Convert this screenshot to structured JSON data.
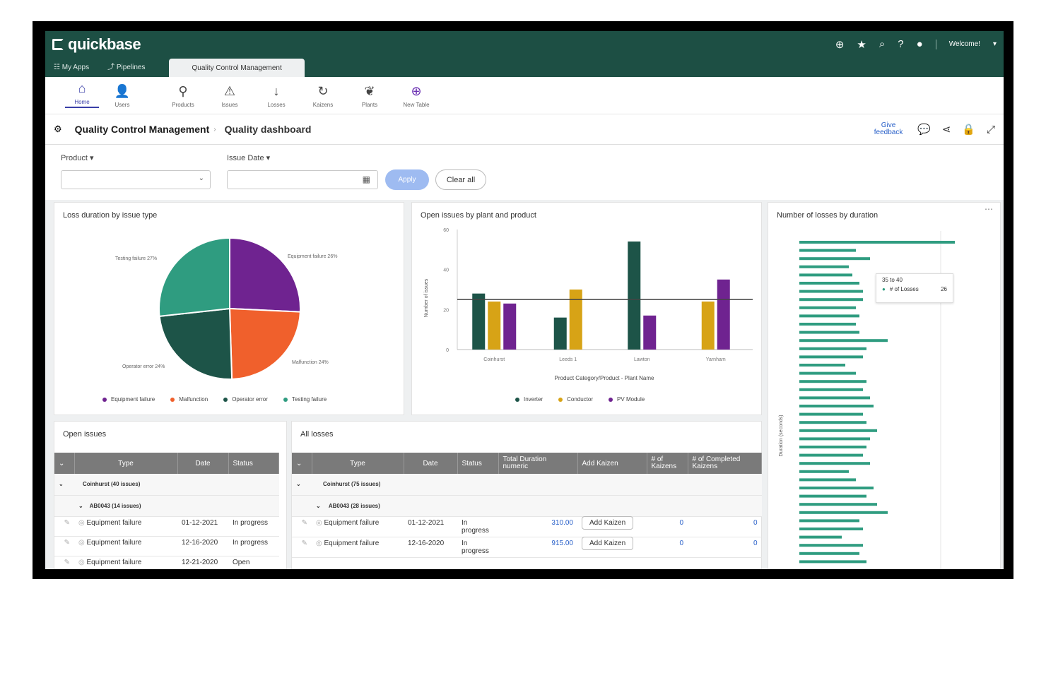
{
  "app": {
    "brand": "quickbase",
    "welcome": "Welcome!",
    "nav": {
      "my_apps": "My Apps",
      "pipelines": "Pipelines",
      "app_tab": "Quality Control Management"
    }
  },
  "tables": [
    "Home",
    "Users",
    "Products",
    "Issues",
    "Losses",
    "Kaizens",
    "Plants",
    "New Table"
  ],
  "breadcrumb": {
    "app": "Quality Control Management",
    "page": "Quality dashboard"
  },
  "give_feedback": "Give feedback",
  "filters": {
    "product_label": "Product",
    "issue_date_label": "Issue Date",
    "apply": "Apply",
    "clear_all": "Clear all"
  },
  "pie": {
    "title": "Loss duration by issue type",
    "labels": [
      "Equipment failure 26%",
      "Malfunction 24%",
      "Operator error 24%",
      "Testing failure 27%"
    ],
    "legend": [
      "Equipment failure",
      "Malfunction",
      "Operator error",
      "Testing failure"
    ]
  },
  "bar": {
    "title": "Open issues by plant and product",
    "ylabel": "Number of issues",
    "xlabel": "Product Category/Product - Plant Name",
    "legend": [
      "Inverter",
      "Conductor",
      "PV Module"
    ],
    "yticks": [
      "60",
      "40",
      "20",
      "0"
    ],
    "categories": [
      "Coinhurst",
      "Leeds 1",
      "Lawton",
      "Yarnham"
    ]
  },
  "hbar": {
    "title": "Number of losses by duration",
    "ylabel": "Duration (seconds)",
    "tooltip_range": "35 to 40",
    "tooltip_label": "# of Losses",
    "tooltip_value": "26"
  },
  "open_issues": {
    "title": "Open issues",
    "columns": [
      "Type",
      "Date",
      "Status"
    ],
    "group1": "Coinhurst (40 issues)",
    "group2": "AB0043 (14 issues)",
    "rows": [
      [
        "Equipment failure",
        "01-12-2021",
        "In progress"
      ],
      [
        "Equipment failure",
        "12-16-2020",
        "In progress"
      ],
      [
        "Equipment failure",
        "12-21-2020",
        "Open"
      ]
    ]
  },
  "all_losses": {
    "title": "All losses",
    "columns": [
      "Type",
      "Date",
      "Status",
      "Total Duration numeric",
      "Add Kaizen",
      "# of Kaizens",
      "# of Completed Kaizens"
    ],
    "group1": "Coinhurst (75 issues)",
    "group2": "AB0043 (28 issues)",
    "rows": [
      [
        "Equipment failure",
        "01-12-2021",
        "In progress",
        "310.00",
        "Add Kaizen",
        "0",
        "0"
      ],
      [
        "Equipment failure",
        "12-16-2020",
        "In progress",
        "915.00",
        "Add Kaizen",
        "0",
        "0"
      ]
    ]
  },
  "colors": {
    "header": "#1d4f44",
    "purple": "#6f2390",
    "orange": "#f0602c",
    "dark_green": "#1d5448",
    "teal": "#2f9c80",
    "gold": "#d7a316"
  },
  "chart_data": [
    {
      "type": "pie",
      "title": "Loss duration by issue type",
      "categories": [
        "Equipment failure",
        "Malfunction",
        "Operator error",
        "Testing failure"
      ],
      "values": [
        26,
        24,
        24,
        27
      ]
    },
    {
      "type": "bar",
      "title": "Open issues by plant and product",
      "xlabel": "Product Category/Product - Plant Name",
      "ylabel": "Number of issues",
      "categories": [
        "Coinhurst",
        "Leeds 1",
        "Lawton",
        "Yarnham"
      ],
      "ylim": [
        0,
        60
      ],
      "reference_line": 25,
      "series": [
        {
          "name": "Inverter",
          "values": [
            28,
            16,
            54,
            0
          ]
        },
        {
          "name": "Conductor",
          "values": [
            24,
            30,
            0,
            24
          ]
        },
        {
          "name": "PV Module",
          "values": [
            23,
            0,
            17,
            35
          ]
        }
      ]
    },
    {
      "type": "bar",
      "orientation": "horizontal",
      "title": "Number of losses by duration",
      "ylabel": "Duration (seconds)",
      "values": [
        44,
        16,
        20,
        14,
        15,
        17,
        18,
        18,
        16,
        17,
        16,
        17,
        25,
        19,
        18,
        13,
        16,
        19,
        18,
        20,
        21,
        18,
        19,
        22,
        20,
        19,
        18,
        20,
        14,
        16,
        21,
        19,
        22,
        25,
        17,
        18,
        12,
        18,
        17,
        19
      ]
    }
  ]
}
